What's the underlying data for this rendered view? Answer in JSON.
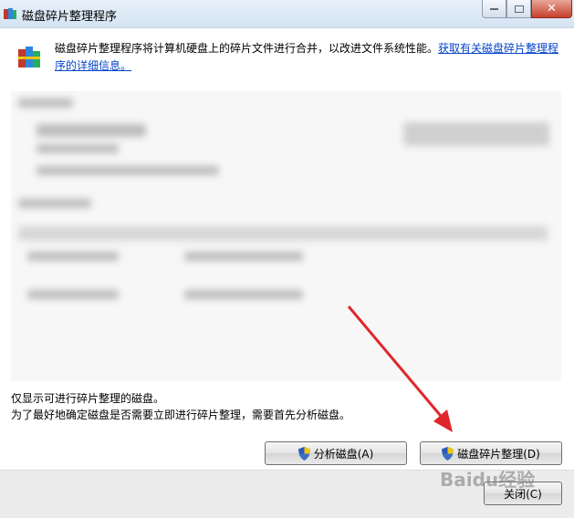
{
  "window": {
    "title": "磁盘碎片整理程序"
  },
  "header": {
    "description": "磁盘碎片整理程序将计算机硬盘上的碎片文件进行合并，以改进文件系统性能。",
    "link_text": "获取有关磁盘碎片整理程序的详细信息。"
  },
  "info": {
    "line1": "仅显示可进行碎片整理的磁盘。",
    "line2": "为了最好地确定磁盘是否需要立即进行碎片整理，需要首先分析磁盘。"
  },
  "buttons": {
    "analyze": "分析磁盘(A)",
    "defrag": "磁盘碎片整理(D)",
    "close": "关闭(C)"
  },
  "watermark": "Baidu经验",
  "icons": {
    "app": "defrag-app-icon",
    "shield": "uac-shield-icon"
  },
  "colors": {
    "link": "#0645c9",
    "arrow": "#e0262b"
  }
}
